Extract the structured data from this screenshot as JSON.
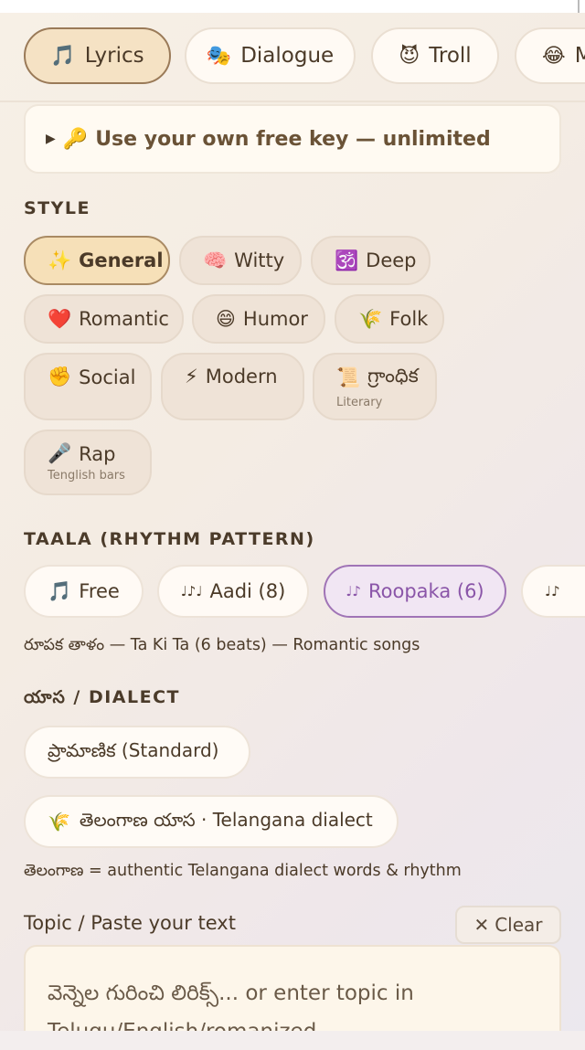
{
  "modes": [
    {
      "icon": "🎵",
      "icon_name": "music-note-icon",
      "label": "Lyrics",
      "active": true
    },
    {
      "icon": "🎭",
      "icon_name": "theater-masks-icon",
      "label": "Dialogue",
      "active": false
    },
    {
      "icon": "😈",
      "icon_name": "devil-icon",
      "label": "Troll",
      "active": false
    },
    {
      "icon": "😂",
      "icon_name": "laughing-icon",
      "label": "M",
      "active": false
    }
  ],
  "key_banner": {
    "arrow": "▶",
    "icon": "🔑",
    "text": "Use your own free key — unlimited"
  },
  "style": {
    "heading": "STYLE",
    "chips": [
      {
        "icon": "✨",
        "label": "General",
        "sub": "",
        "active": true
      },
      {
        "icon": "🧠",
        "label": "Witty",
        "sub": ""
      },
      {
        "icon": "🕉️",
        "label": "Deep",
        "sub": ""
      },
      {
        "icon": "❤️",
        "label": "Romantic",
        "sub": ""
      },
      {
        "icon": "😄",
        "label": "Humor",
        "sub": ""
      },
      {
        "icon": "🌾",
        "label": "Folk",
        "sub": ""
      },
      {
        "icon": "✊",
        "label": "Social",
        "sub": ""
      },
      {
        "icon": "⚡",
        "label": "Modern",
        "sub": ""
      },
      {
        "icon": "📜",
        "label": "గ్రాంధిక",
        "sub": "Literary"
      },
      {
        "icon": "🎤",
        "label": "Rap",
        "sub": "Tenglish bars"
      }
    ]
  },
  "taala": {
    "heading": "TAALA (RHYTHM PATTERN)",
    "options": [
      {
        "icon": "🎵",
        "label": "Free",
        "active": false
      },
      {
        "icon": "♩♪♩",
        "label": "Aadi (8)",
        "active": false
      },
      {
        "icon": "♩♪",
        "label": "Roopaka (6)",
        "active": true
      },
      {
        "icon": "♩♪",
        "label": "",
        "active": false
      }
    ],
    "note": "రూపక తాళం — Ta Ki Ta (6 beats) — Romantic songs"
  },
  "dialect": {
    "heading": "యాస / DIALECT",
    "options": [
      {
        "icon": "",
        "label": "ప్రామాణిక (Standard)"
      },
      {
        "icon": "🌾",
        "label": "తెలంగాణ యాస · Telangana dialect"
      }
    ],
    "note": "తెలంగాణ = authentic Telangana dialect words & rhythm"
  },
  "topic": {
    "label": "Topic / Paste your text",
    "clear_icon": "✕",
    "clear_label": "Clear",
    "placeholder": "వెన్నెల గురించి లిరిక్స్... or enter topic in Telugu/English/romanized"
  }
}
